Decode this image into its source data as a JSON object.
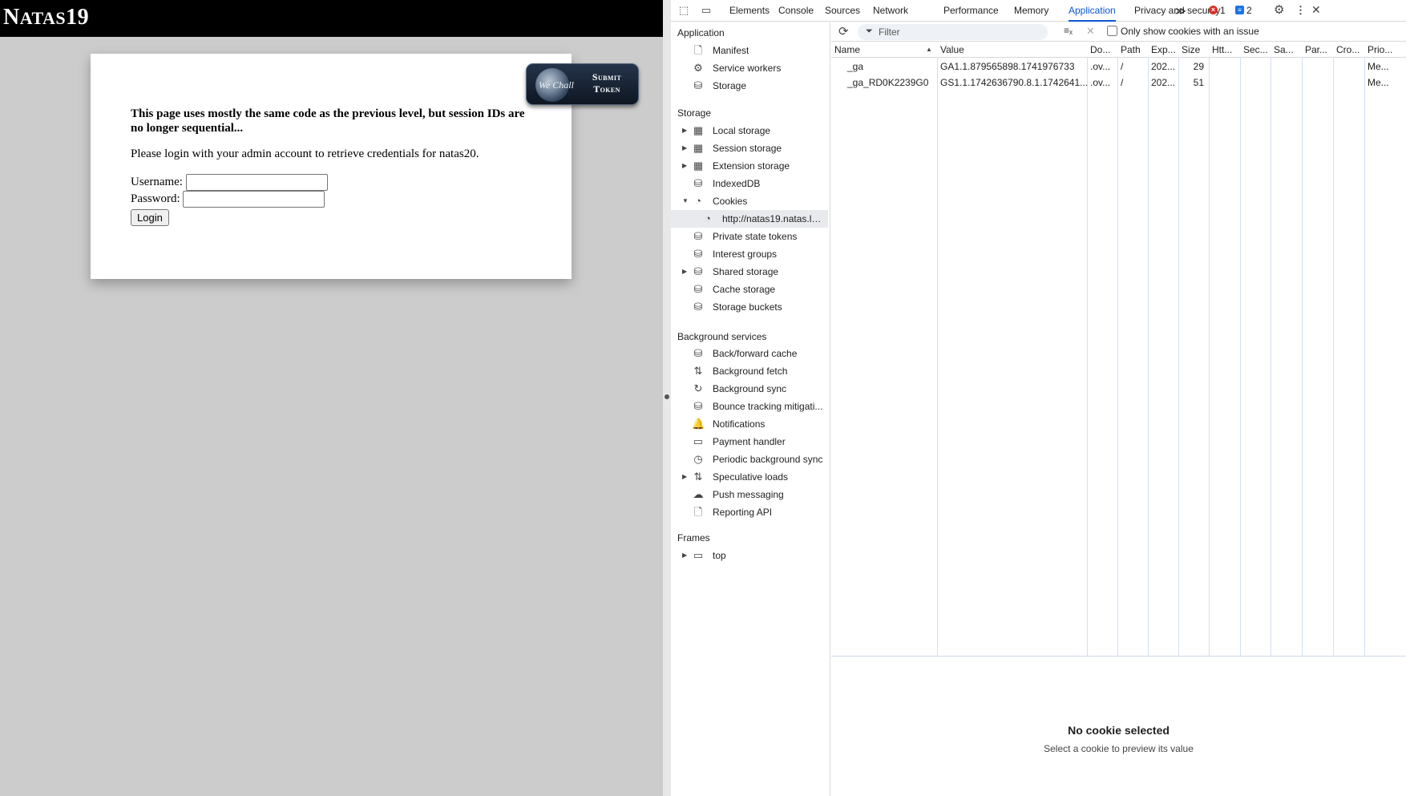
{
  "page": {
    "site_title_big": "N",
    "site_title_small": "ATAS",
    "site_title_num": "19",
    "wechall": {
      "left_text": "We Chall",
      "line1": "Submit",
      "line2": "Token"
    },
    "intro": "This page uses mostly the same code as the previous level, but session IDs are no longer sequential...",
    "instructions": "Please login with your admin account to retrieve credentials for natas20.",
    "username_label": "Username:",
    "username_value": "",
    "password_label": "Password:",
    "password_value": "",
    "login_button": "Login"
  },
  "devtools": {
    "tabs": [
      "Elements",
      "Console",
      "Sources",
      "Network",
      "Performance",
      "Memory",
      "Application",
      "Privacy and security"
    ],
    "active_tab": "Application",
    "more_tabs": "≫",
    "error_count": "1",
    "message_count": "2",
    "sidebar": {
      "application_title": "Application",
      "application_items": [
        {
          "label": "Manifest",
          "icon": "file-icon"
        },
        {
          "label": "Service workers",
          "icon": "gears-icon"
        },
        {
          "label": "Storage",
          "icon": "database-icon"
        }
      ],
      "storage_title": "Storage",
      "storage_items": [
        {
          "label": "Local storage",
          "icon": "table-icon",
          "expandable": true
        },
        {
          "label": "Session storage",
          "icon": "table-icon",
          "expandable": true
        },
        {
          "label": "Extension storage",
          "icon": "table-icon",
          "expandable": true
        },
        {
          "label": "IndexedDB",
          "icon": "database-icon",
          "expandable": false
        },
        {
          "label": "Cookies",
          "icon": "cookie-icon",
          "expanded": true
        },
        {
          "label": "http://natas19.natas.la...",
          "icon": "cookie-icon",
          "child": true,
          "selected": true
        },
        {
          "label": "Private state tokens",
          "icon": "database-icon"
        },
        {
          "label": "Interest groups",
          "icon": "database-icon"
        },
        {
          "label": "Shared storage",
          "icon": "database-icon",
          "expandable": true
        },
        {
          "label": "Cache storage",
          "icon": "database-icon"
        },
        {
          "label": "Storage buckets",
          "icon": "database-icon"
        }
      ],
      "background_title": "Background services",
      "background_items": [
        {
          "label": "Back/forward cache",
          "icon": "database-icon"
        },
        {
          "label": "Background fetch",
          "icon": "arrows-updown-icon"
        },
        {
          "label": "Background sync",
          "icon": "sync-icon"
        },
        {
          "label": "Bounce tracking mitigati...",
          "icon": "database-icon"
        },
        {
          "label": "Notifications",
          "icon": "bell-icon"
        },
        {
          "label": "Payment handler",
          "icon": "card-icon"
        },
        {
          "label": "Periodic background sync",
          "icon": "clock-icon"
        },
        {
          "label": "Speculative loads",
          "icon": "arrows-updown-icon",
          "expandable": true
        },
        {
          "label": "Push messaging",
          "icon": "cloud-icon"
        },
        {
          "label": "Reporting API",
          "icon": "file-icon"
        }
      ],
      "frames_title": "Frames",
      "frames_items": [
        {
          "label": "top",
          "icon": "window-icon",
          "expandable": true
        }
      ]
    },
    "cookies": {
      "filter_placeholder": "Filter",
      "only_issue_label": "Only show cookies with an issue",
      "columns": [
        "Name",
        "Value",
        "Do...",
        "Path",
        "Exp...",
        "Size",
        "Htt...",
        "Sec...",
        "Sa...",
        "Par...",
        "Cro...",
        "Prio..."
      ],
      "rows": [
        [
          "_ga",
          "GA1.1.879565898.1741976733",
          ".ov...",
          "/",
          "202...",
          "29",
          "",
          "",
          "",
          "",
          "",
          "Me..."
        ],
        [
          "_ga_RD0K2239G0",
          "GS1.1.1742636790.8.1.1742641...",
          ".ov...",
          "/",
          "202...",
          "51",
          "",
          "",
          "",
          "",
          "",
          "Me..."
        ]
      ],
      "no_selection_title": "No cookie selected",
      "no_selection_sub": "Select a cookie to preview its value"
    }
  }
}
